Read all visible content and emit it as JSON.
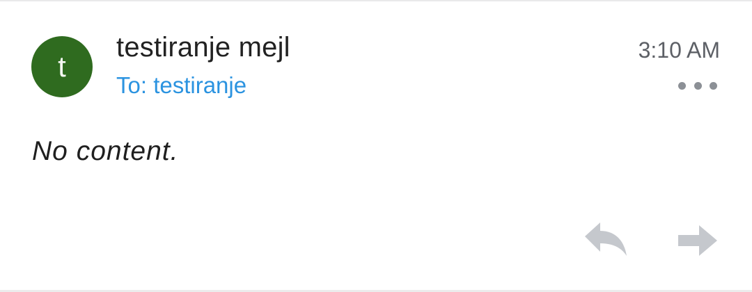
{
  "message": {
    "avatar_letter": "t",
    "sender": "testiranje mejl",
    "recipient": "To: testiranje",
    "time": "3:10 AM",
    "body": "No content."
  },
  "icons": {
    "more": "more-horizontal-icon",
    "reply": "reply-icon",
    "forward": "forward-icon"
  },
  "colors": {
    "avatar_background": "#2f6b1f",
    "recipient_link": "#2b93e0",
    "action_icons": "#c5c8cd"
  }
}
